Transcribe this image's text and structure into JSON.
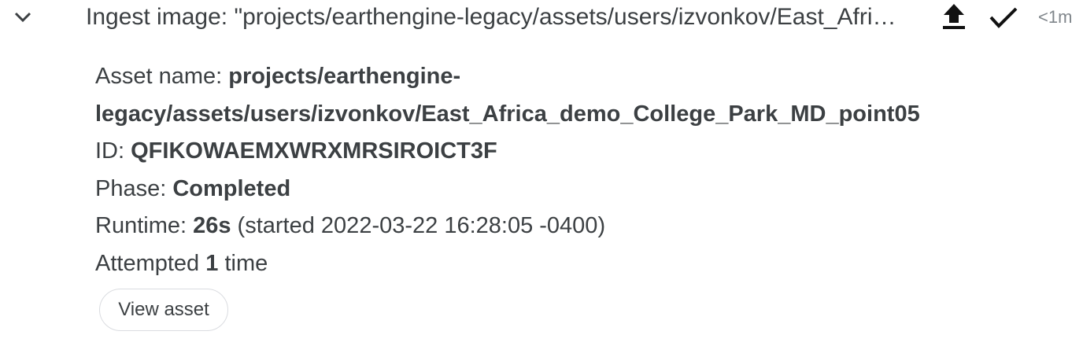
{
  "task": {
    "expand_icon": "chevron-down-icon",
    "title": "Ingest image: \"projects/earthengine-legacy/assets/users/izvonkov/East_Africa_demo_College_Park_MD_point05\"",
    "type_icon": "upload-icon",
    "status_icon": "check-icon",
    "elapsed": "<1m"
  },
  "details": {
    "asset_name_label": "Asset name: ",
    "asset_name_line1": "projects/earthengine-",
    "asset_name_line2": "legacy/assets/users/izvonkov/East_Africa_demo_College_Park_MD_point05",
    "id_label": "ID: ",
    "id_value": "QFIKOWAEMXWRXMRSIROICT3F",
    "phase_label": "Phase: ",
    "phase_value": "Completed",
    "runtime_label": "Runtime: ",
    "runtime_value": "26s",
    "runtime_started": " (started 2022-03-22 16:28:05 -0400)",
    "attempted_prefix": "Attempted ",
    "attempted_count": "1",
    "attempted_suffix": " time"
  },
  "actions": {
    "view_asset_label": "View asset"
  },
  "colors": {
    "text": "#3c4043",
    "muted": "#80868b",
    "button_border": "#dadce0"
  }
}
